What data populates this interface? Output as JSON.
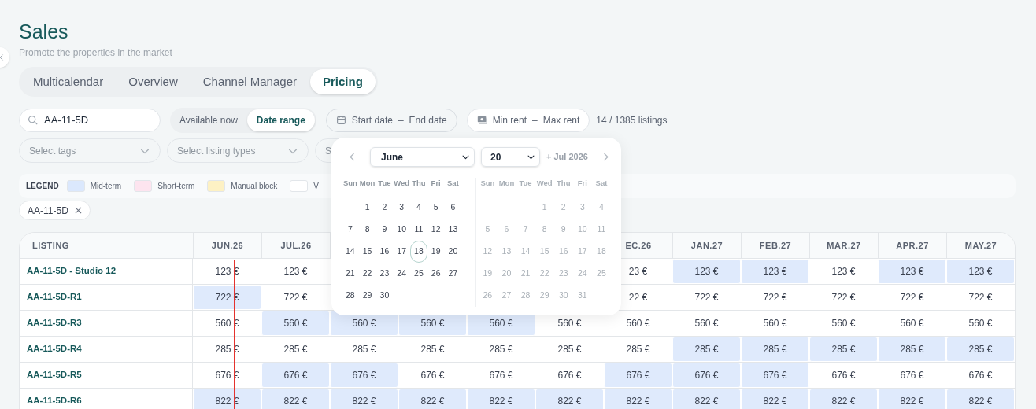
{
  "page": {
    "title": "Sales",
    "subtitle": "Promote the properties in the market"
  },
  "tabs": [
    {
      "label": "Multicalendar",
      "selected": false
    },
    {
      "label": "Overview",
      "selected": false
    },
    {
      "label": "Channel Manager",
      "selected": false
    },
    {
      "label": "Pricing",
      "selected": true
    }
  ],
  "search": {
    "value": "AA-11-5D"
  },
  "availability_toggle": [
    {
      "label": "Available now",
      "selected": false
    },
    {
      "label": "Date range",
      "selected": true
    }
  ],
  "date_range": {
    "start_placeholder": "Start date",
    "separator": "–",
    "end_placeholder": "End date"
  },
  "rent_range": {
    "min_placeholder": "Min rent",
    "separator": "–",
    "max_placeholder": "Max rent"
  },
  "listing_count": "14 / 1385 listings",
  "dropdowns": [
    {
      "kind": "select",
      "placeholder": "Select tags"
    },
    {
      "kind": "select",
      "placeholder": "Select listing types"
    },
    {
      "kind": "covered",
      "placeholder": "S"
    }
  ],
  "legend": {
    "title": "LEGEND",
    "items": [
      {
        "label": "Mid-term",
        "color": "#dbe8fd"
      },
      {
        "label": "Short-term",
        "color": "#fde4ef"
      },
      {
        "label": "Manual block",
        "color": "#fdf1c4"
      },
      {
        "label": "V",
        "color": "#ffffff"
      }
    ]
  },
  "chips": [
    {
      "label": "AA-11-5D"
    }
  ],
  "date_picker": {
    "month": "June",
    "year": "20",
    "next_label": "+ Jul 2026",
    "months": [
      {
        "faded": false,
        "weekdays": [
          "Sun",
          "Mon",
          "Tue",
          "Wed",
          "Thu",
          "Fri",
          "Sat"
        ],
        "weeks": [
          [
            {
              "kind": "blank"
            },
            {
              "kind": "day",
              "label": "1",
              "today": false
            },
            {
              "kind": "day",
              "label": "2",
              "today": false
            },
            {
              "kind": "day",
              "label": "3",
              "today": false
            },
            {
              "kind": "day",
              "label": "4",
              "today": false
            },
            {
              "kind": "day",
              "label": "5",
              "today": false
            },
            {
              "kind": "day",
              "label": "6",
              "today": false
            }
          ],
          [
            {
              "kind": "day",
              "label": "7",
              "today": false
            },
            {
              "kind": "day",
              "label": "8",
              "today": false
            },
            {
              "kind": "day",
              "label": "9",
              "today": false
            },
            {
              "kind": "day",
              "label": "10",
              "today": false
            },
            {
              "kind": "day",
              "label": "11",
              "today": false
            },
            {
              "kind": "day",
              "label": "12",
              "today": false
            },
            {
              "kind": "day",
              "label": "13",
              "today": false
            }
          ],
          [
            {
              "kind": "day",
              "label": "14",
              "today": false
            },
            {
              "kind": "day",
              "label": "15",
              "today": false
            },
            {
              "kind": "day",
              "label": "16",
              "today": false
            },
            {
              "kind": "day",
              "label": "17",
              "today": false
            },
            {
              "kind": "day",
              "label": "18",
              "today": true
            },
            {
              "kind": "day",
              "label": "19",
              "today": false
            },
            {
              "kind": "day",
              "label": "20",
              "today": false
            }
          ],
          [
            {
              "kind": "day",
              "label": "21",
              "today": false
            },
            {
              "kind": "day",
              "label": "22",
              "today": false
            },
            {
              "kind": "day",
              "label": "23",
              "today": false
            },
            {
              "kind": "day",
              "label": "24",
              "today": false
            },
            {
              "kind": "day",
              "label": "25",
              "today": false
            },
            {
              "kind": "day",
              "label": "26",
              "today": false
            },
            {
              "kind": "day",
              "label": "27",
              "today": false
            }
          ],
          [
            {
              "kind": "day",
              "label": "28",
              "today": false
            },
            {
              "kind": "day",
              "label": "29",
              "today": false
            },
            {
              "kind": "day",
              "label": "30",
              "today": false
            }
          ]
        ]
      },
      {
        "faded": true,
        "weekdays": [
          "Sun",
          "Mon",
          "Tue",
          "Wed",
          "Thu",
          "Fri",
          "Sat"
        ],
        "weeks": [
          [
            {
              "kind": "blank"
            },
            {
              "kind": "blank"
            },
            {
              "kind": "blank"
            },
            {
              "kind": "day",
              "label": "1",
              "today": false
            },
            {
              "kind": "day",
              "label": "2",
              "today": false
            },
            {
              "kind": "day",
              "label": "3",
              "today": false
            },
            {
              "kind": "day",
              "label": "4",
              "today": false
            }
          ],
          [
            {
              "kind": "day",
              "label": "5",
              "today": false
            },
            {
              "kind": "day",
              "label": "6",
              "today": false
            },
            {
              "kind": "day",
              "label": "7",
              "today": false
            },
            {
              "kind": "day",
              "label": "8",
              "today": false
            },
            {
              "kind": "day",
              "label": "9",
              "today": false
            },
            {
              "kind": "day",
              "label": "10",
              "today": false
            },
            {
              "kind": "day",
              "label": "11",
              "today": false
            }
          ],
          [
            {
              "kind": "day",
              "label": "12",
              "today": false
            },
            {
              "kind": "day",
              "label": "13",
              "today": false
            },
            {
              "kind": "day",
              "label": "14",
              "today": false
            },
            {
              "kind": "day",
              "label": "15",
              "today": false
            },
            {
              "kind": "day",
              "label": "16",
              "today": false
            },
            {
              "kind": "day",
              "label": "17",
              "today": false
            },
            {
              "kind": "day",
              "label": "18",
              "today": false
            }
          ],
          [
            {
              "kind": "day",
              "label": "19",
              "today": false
            },
            {
              "kind": "day",
              "label": "20",
              "today": false
            },
            {
              "kind": "day",
              "label": "21",
              "today": false
            },
            {
              "kind": "day",
              "label": "22",
              "today": false
            },
            {
              "kind": "day",
              "label": "23",
              "today": false
            },
            {
              "kind": "day",
              "label": "24",
              "today": false
            },
            {
              "kind": "day",
              "label": "25",
              "today": false
            }
          ],
          [
            {
              "kind": "day",
              "label": "26",
              "today": false
            },
            {
              "kind": "day",
              "label": "27",
              "today": false
            },
            {
              "kind": "day",
              "label": "28",
              "today": false
            },
            {
              "kind": "day",
              "label": "29",
              "today": false
            },
            {
              "kind": "day",
              "label": "30",
              "today": false
            },
            {
              "kind": "day",
              "label": "31",
              "today": false
            }
          ]
        ]
      }
    ]
  },
  "table": {
    "columns": [
      "LISTING",
      "JUN.26",
      "JUL.26",
      "",
      "",
      "",
      "",
      "EC.26",
      "JAN.27",
      "FEB.27",
      "MAR.27",
      "APR.27",
      "MAY.27"
    ],
    "rows": [
      {
        "cells": [
          {
            "value": "AA-11-5D - Studio 12",
            "kind": "listing"
          },
          {
            "value": "123 €",
            "booked": false
          },
          {
            "value": "123 €",
            "booked": false
          },
          "",
          "",
          "",
          "",
          {
            "value": "23 €",
            "booked": false
          },
          {
            "value": "123 €",
            "booked": true
          },
          {
            "value": "123 €",
            "booked": true
          },
          {
            "value": "123 €",
            "booked": false
          },
          {
            "value": "123 €",
            "booked": true
          },
          {
            "value": "123 €",
            "booked": true
          }
        ]
      },
      {
        "cells": [
          {
            "value": "AA-11-5D-R1",
            "kind": "listing"
          },
          {
            "value": "722 €",
            "booked": true
          },
          {
            "value": "722 €",
            "booked": false
          },
          "",
          "",
          "",
          "",
          {
            "value": "22 €",
            "booked": false
          },
          {
            "value": "722 €",
            "booked": false
          },
          {
            "value": "722 €",
            "booked": false
          },
          {
            "value": "722 €",
            "booked": false
          },
          {
            "value": "722 €",
            "booked": false
          },
          {
            "value": "722 €",
            "booked": false
          }
        ]
      },
      {
        "cells": [
          {
            "value": "AA-11-5D-R3",
            "kind": "listing"
          },
          {
            "value": "560 €",
            "booked": false
          },
          {
            "value": "560 €",
            "booked": true
          },
          {
            "value": "560 €",
            "booked": true
          },
          {
            "value": "560 €",
            "booked": true
          },
          {
            "value": "560 €",
            "booked": true
          },
          {
            "value": "560 €",
            "booked": false
          },
          {
            "value": "560 €",
            "booked": false
          },
          {
            "value": "560 €",
            "booked": false
          },
          {
            "value": "560 €",
            "booked": false
          },
          {
            "value": "560 €",
            "booked": false
          },
          {
            "value": "560 €",
            "booked": false
          },
          {
            "value": "560 €",
            "booked": false
          }
        ]
      },
      {
        "cells": [
          {
            "value": "AA-11-5D-R4",
            "kind": "listing"
          },
          {
            "value": "285 €",
            "booked": false
          },
          {
            "value": "285 €",
            "booked": false
          },
          {
            "value": "285 €",
            "booked": false
          },
          {
            "value": "285 €",
            "booked": false
          },
          {
            "value": "285 €",
            "booked": false
          },
          {
            "value": "285 €",
            "booked": false
          },
          {
            "value": "285 €",
            "booked": false
          },
          {
            "value": "285 €",
            "booked": true
          },
          {
            "value": "285 €",
            "booked": true
          },
          {
            "value": "285 €",
            "booked": true
          },
          {
            "value": "285 €",
            "booked": true
          },
          {
            "value": "285 €",
            "booked": true
          }
        ]
      },
      {
        "cells": [
          {
            "value": "AA-11-5D-R5",
            "kind": "listing"
          },
          {
            "value": "676 €",
            "booked": false
          },
          {
            "value": "676 €",
            "booked": true
          },
          {
            "value": "676 €",
            "booked": true
          },
          {
            "value": "676 €",
            "booked": false
          },
          {
            "value": "676 €",
            "booked": false
          },
          {
            "value": "676 €",
            "booked": false
          },
          {
            "value": "676 €",
            "booked": true
          },
          {
            "value": "676 €",
            "booked": true
          },
          {
            "value": "676 €",
            "booked": true
          },
          {
            "value": "676 €",
            "booked": false
          },
          {
            "value": "676 €",
            "booked": false
          },
          {
            "value": "676 €",
            "booked": false
          }
        ]
      },
      {
        "cells": [
          {
            "value": "AA-11-5D-R6",
            "kind": "listing"
          },
          {
            "value": "822 €",
            "booked": true
          },
          {
            "value": "822 €",
            "booked": true
          },
          {
            "value": "822 €",
            "booked": true
          },
          {
            "value": "822 €",
            "booked": true
          },
          {
            "value": "822 €",
            "booked": true
          },
          {
            "value": "822 €",
            "booked": true
          },
          {
            "value": "822 €",
            "booked": true
          },
          {
            "value": "822 €",
            "booked": true
          },
          {
            "value": "822 €",
            "booked": true
          },
          {
            "value": "822 €",
            "booked": true
          },
          {
            "value": "822 €",
            "booked": true
          },
          {
            "value": "822 €",
            "booked": true
          }
        ]
      }
    ]
  }
}
